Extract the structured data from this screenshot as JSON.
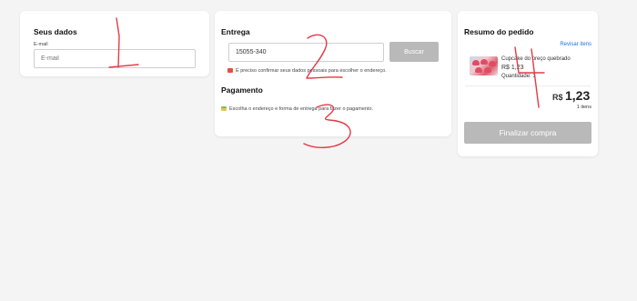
{
  "dados": {
    "title": "Seus dados",
    "email_label": "E-mail",
    "email_placeholder": "E-mail",
    "email_value": ""
  },
  "entrega": {
    "title": "Entrega",
    "cep_value": "15055-340",
    "buscar_label": "Buscar",
    "notice": "É preciso confirmar seus dados pessoais para escolher o endereço.",
    "pagamento_title": "Pagamento",
    "pagamento_notice": "Escolha o endereço e forma de entrega para fazer o pagamento."
  },
  "resumo": {
    "title": "Resumo do pedido",
    "revisar_label": "Revisar itens",
    "item_name": "Cupcake do preço quebrado",
    "item_price": "R$ 1,23",
    "item_qty": "Quantidade: 1",
    "total_currency": "R$",
    "total_value": "1,23",
    "total_items": "1 itens",
    "finalizar_label": "Finalizar compra"
  },
  "annotations": {
    "color": "#e23b4a",
    "numbers": [
      "1",
      "2",
      "3",
      "4"
    ]
  }
}
